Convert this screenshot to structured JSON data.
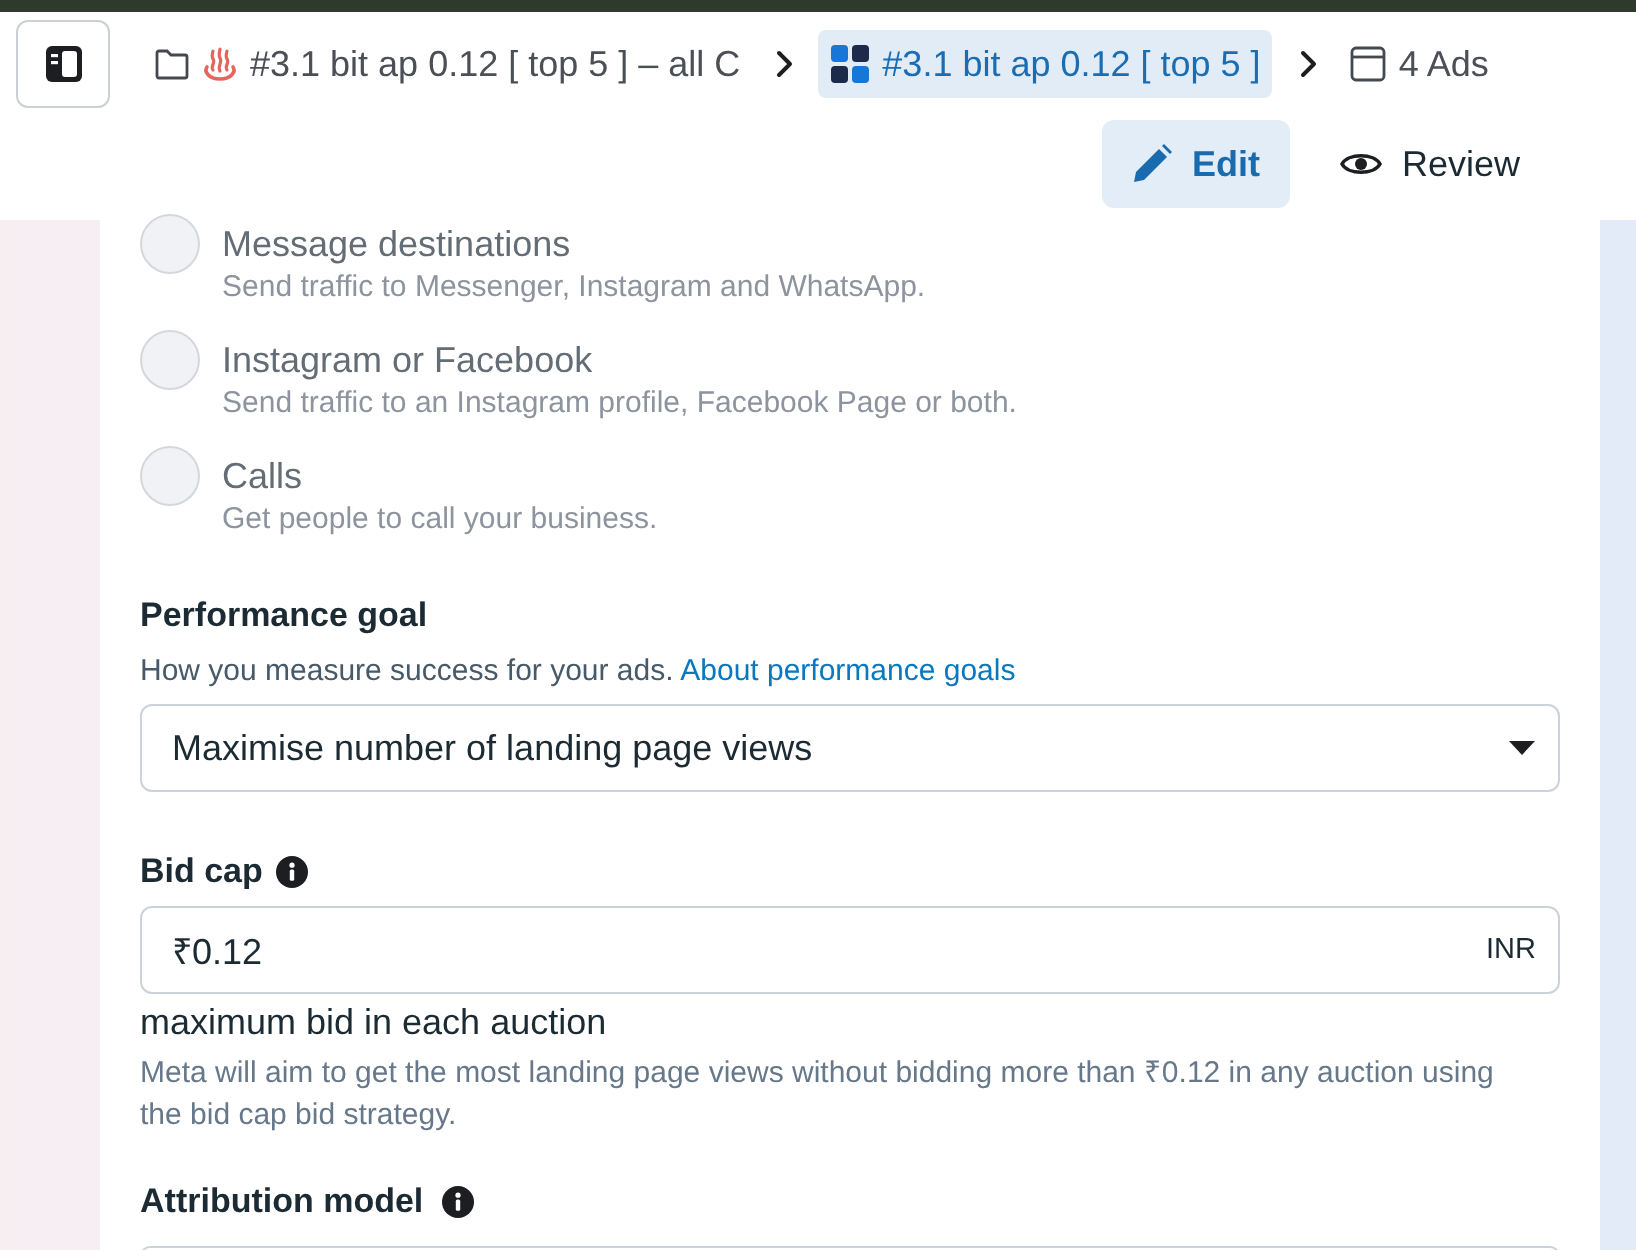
{
  "header": {
    "breadcrumbs": [
      {
        "kind": "campaign",
        "label": "#3.1 bit ap 0.12 [ top 5 ] – all C",
        "selected": false
      },
      {
        "kind": "ad_set",
        "label": "#3.1 bit ap 0.12 [ top 5 ]",
        "selected": true
      },
      {
        "kind": "ads",
        "label": "4 Ads",
        "selected": false
      }
    ],
    "modes": [
      {
        "kind": "edit",
        "label": "Edit",
        "selected": true
      },
      {
        "kind": "review",
        "label": "Review",
        "selected": false
      }
    ]
  },
  "destinations": [
    {
      "title": "Message destinations",
      "description": "Send traffic to Messenger, Instagram and WhatsApp.",
      "selected": false,
      "disabled": true
    },
    {
      "title": "Instagram or Facebook",
      "description": "Send traffic to an Instagram profile, Facebook Page or both.",
      "selected": false,
      "disabled": true
    },
    {
      "title": "Calls",
      "description": "Get people to call your business.",
      "selected": false,
      "disabled": true
    }
  ],
  "performance_goal": {
    "label": "Performance goal",
    "help": "How you measure success for your ads.",
    "link": "About performance goals",
    "value": "Maximise number of landing page views"
  },
  "bid_cap": {
    "label": "Bid cap",
    "value": "₹0.12",
    "currency": "INR",
    "caption": "maximum bid in each auction",
    "note": "Meta will aim to get the most landing page views without bidding more than ₹0.12 in any auction using the bid cap bid strategy."
  },
  "attribution_model": {
    "label": "Attribution model"
  }
}
